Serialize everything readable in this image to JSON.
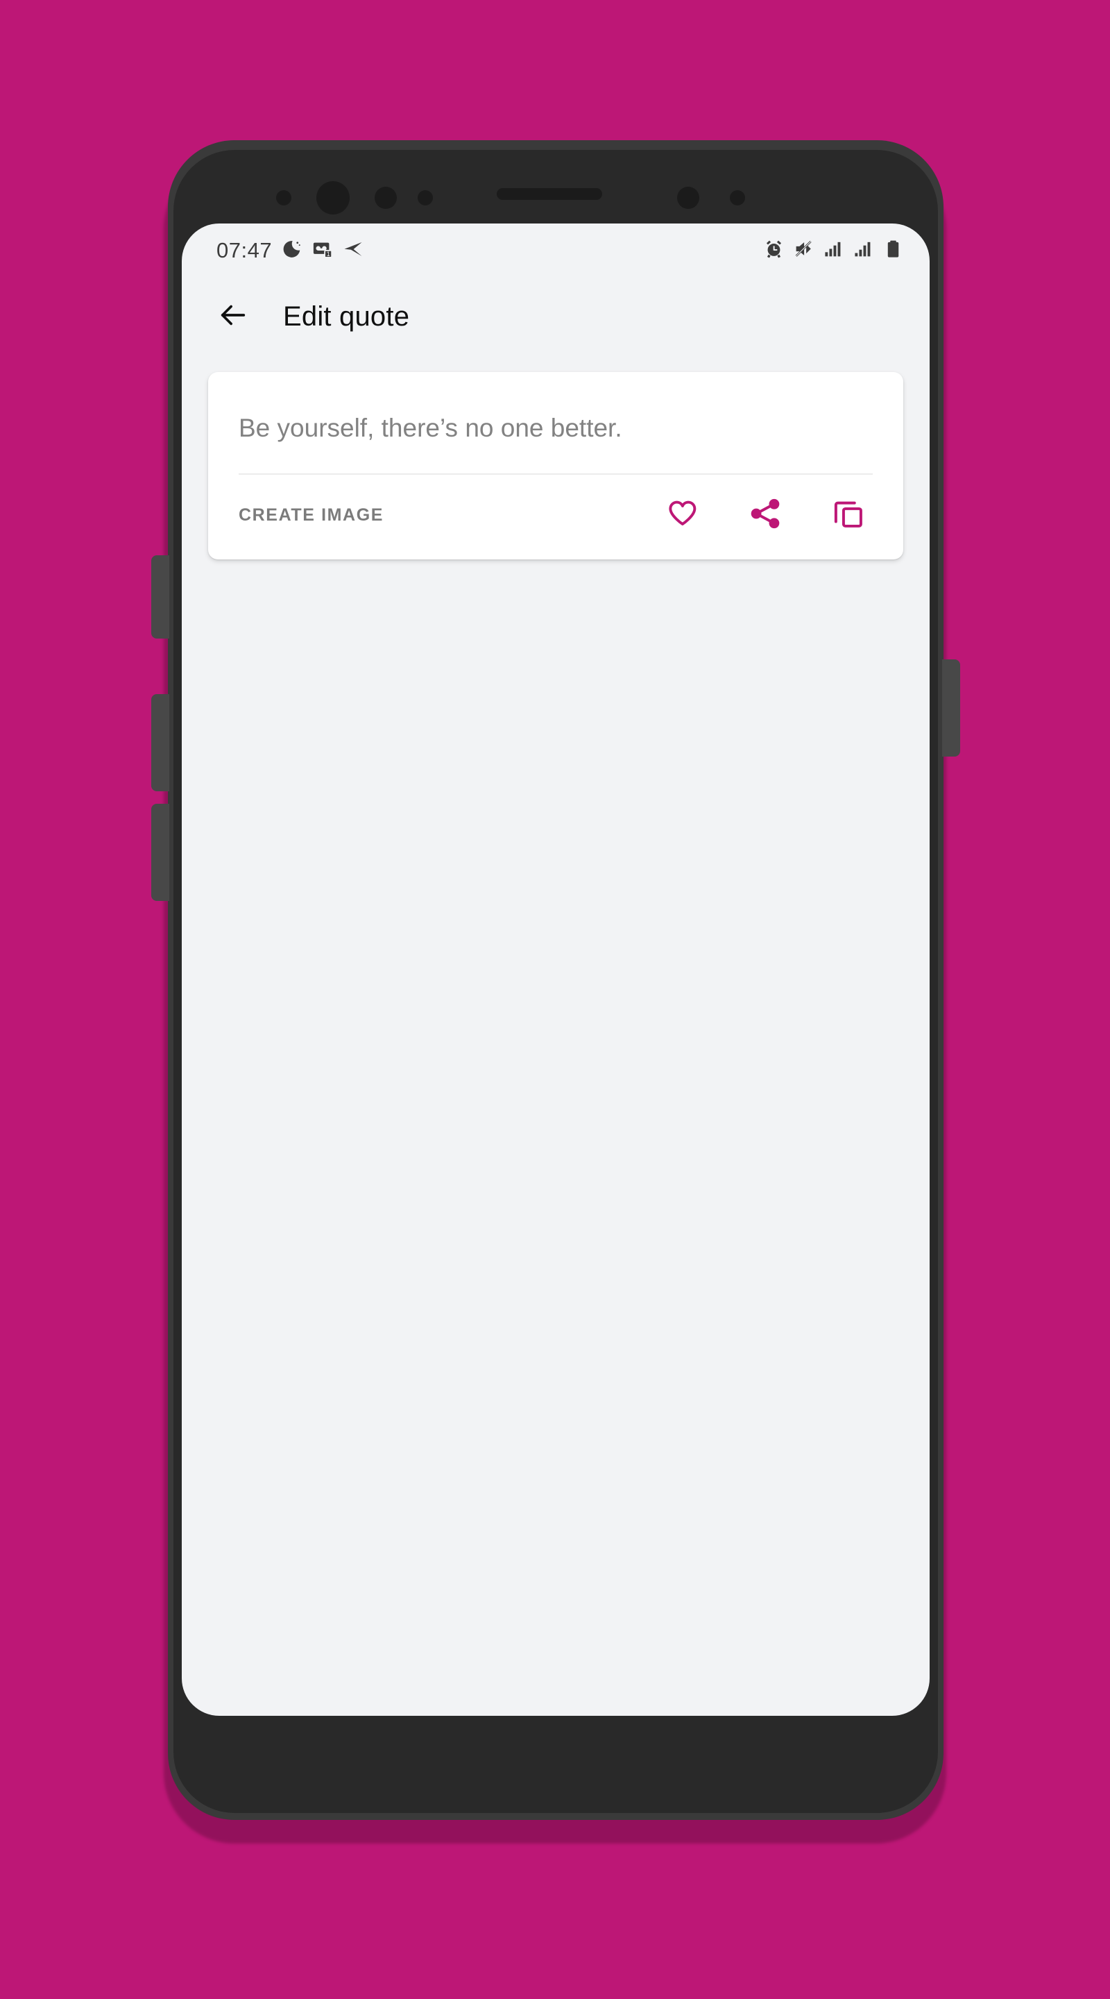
{
  "theme": {
    "background_color": "#bd1776",
    "accent_color": "#bd1776",
    "screen_background": "#f2f3f5",
    "card_background": "#ffffff",
    "quote_text_color": "#828282",
    "title_color": "#101010",
    "status_icon_color": "#3c3c3c"
  },
  "status_bar": {
    "time": "07:47",
    "left_icons": [
      {
        "name": "do-not-disturb-moon-icon",
        "label": "Do not disturb"
      },
      {
        "name": "voicemail-icon",
        "label": "Voicemail",
        "badge": "1"
      },
      {
        "name": "send-paper-plane-icon",
        "label": "Sending"
      }
    ],
    "right_icons": [
      {
        "name": "alarm-clock-icon",
        "label": "Alarm set"
      },
      {
        "name": "volume-mute-icon",
        "label": "Muted"
      },
      {
        "name": "signal-bars-sim1-icon",
        "label": "Signal SIM 1",
        "bars": 4
      },
      {
        "name": "signal-bars-sim2-icon",
        "label": "Signal SIM 2",
        "bars": 3
      },
      {
        "name": "battery-full-icon",
        "label": "Battery"
      }
    ]
  },
  "app_bar": {
    "back_icon": "arrow-back-icon",
    "title": "Edit quote"
  },
  "quote_card": {
    "quote_text": "Be yourself, there’s no one better.",
    "create_image_label": "CREATE IMAGE",
    "actions": [
      {
        "name": "favorite-heart-icon",
        "label": "Favorite"
      },
      {
        "name": "share-icon",
        "label": "Share"
      },
      {
        "name": "copy-icon",
        "label": "Copy"
      }
    ]
  }
}
